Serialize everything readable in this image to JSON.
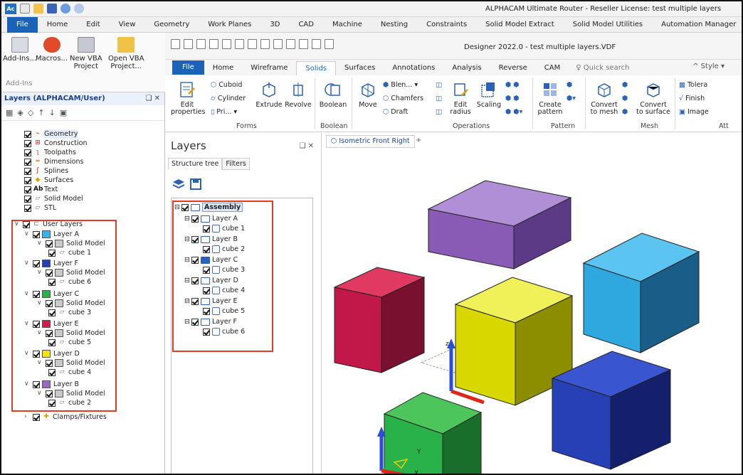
{
  "outer": {
    "app_logo": "Ac",
    "title": "ALPHACAM Ultimate Router - Reseller License: test multiple layers",
    "menu": [
      "File",
      "Home",
      "Edit",
      "View",
      "Geometry",
      "Work Planes",
      "3D",
      "CAD",
      "Machine",
      "Nesting",
      "Constraints",
      "Solid Model Extract",
      "Solid Model Utilities",
      "Automation Manager",
      "Ac"
    ],
    "ribbon": {
      "add_ins": "Add-Ins...",
      "macros": "Macros...",
      "new_vba_1": "New VBA",
      "new_vba_2": "Project",
      "open_vba_1": "Open VBA",
      "open_vba_2": "Project...",
      "group": "Add-Ins"
    }
  },
  "layers_alphacam": {
    "title": "Layers (ALPHACAM/User)",
    "pin": "❑ ✕",
    "tree": [
      {
        "label": "Geometry"
      },
      {
        "label": "Construction"
      },
      {
        "label": "Toolpaths"
      },
      {
        "label": "Dimensions"
      },
      {
        "label": "Splines"
      },
      {
        "label": "Surfaces"
      },
      {
        "label": "Text"
      },
      {
        "label": "Solid Model"
      },
      {
        "label": "STL"
      }
    ],
    "user_layers": "User Layers",
    "layers": [
      {
        "label": "Layer A",
        "color": "#3db2e8",
        "solid": "Solid Model",
        "cube": "cube 1"
      },
      {
        "label": "Layer F",
        "color": "#2240b5",
        "solid": "Solid Model",
        "cube": "cube 6"
      },
      {
        "label": "Layer C",
        "color": "#2ab24a",
        "solid": "Solid Model",
        "cube": "cube 3"
      },
      {
        "label": "Layer E",
        "color": "#d8194c",
        "solid": "Solid Model",
        "cube": "cube 5"
      },
      {
        "label": "Layer D",
        "color": "#f2e600",
        "solid": "Solid Model",
        "cube": "cube 4"
      },
      {
        "label": "Layer B",
        "color": "#9a6ac0",
        "solid": "Solid Model",
        "cube": "cube 2"
      }
    ],
    "clamps": "Clamps/Fixtures"
  },
  "designer": {
    "title": "Designer 2022.0 - test multiple layers.VDF",
    "tabs": [
      "File",
      "Home",
      "Wireframe",
      "Solids",
      "Surfaces",
      "Annotations",
      "Analysis",
      "Reverse",
      "CAM"
    ],
    "active_tab": "Solids",
    "quick_search": "Quick search",
    "style": "Style",
    "ribbon": {
      "edit_props_1": "Edit",
      "edit_props_2": "properties",
      "cuboid": "Cuboid",
      "cylinder": "Cylinder",
      "pri": "Pri...",
      "extrude": "Extrude",
      "revolve": "Revolve",
      "forms": "Forms",
      "boolean": "Boolean",
      "boolean_grp": "Boolean",
      "move": "Move",
      "blen": "Blen...",
      "chamfers": "Chamfers",
      "draft": "Draft",
      "edit_radius_1": "Edit",
      "edit_radius_2": "radius",
      "scaling": "Scaling",
      "operations": "Operations",
      "create_pattern_1": "Create",
      "create_pattern_2": "pattern",
      "pattern": "Pattern",
      "convert_mesh_1": "Convert",
      "convert_mesh_2": "to mesh",
      "convert_surface_1": "Convert",
      "convert_surface_2": "to surface",
      "mesh": "Mesh",
      "tolera": "Tolera",
      "finish": "Finish",
      "image": "Image",
      "att": "Att"
    },
    "layers_panel": {
      "title": "Layers",
      "pin": "❑  ✕",
      "tab_structure": "Structure tree",
      "tab_filters": "Filters",
      "assembly": "Assembly",
      "items": [
        {
          "layer": "Layer A",
          "cube": "cube 1"
        },
        {
          "layer": "Layer B",
          "cube": "cube 2"
        },
        {
          "layer": "Layer C",
          "cube": "cube 3"
        },
        {
          "layer": "Layer D",
          "cube": "cube 4"
        },
        {
          "layer": "Layer E",
          "cube": "cube 5"
        },
        {
          "layer": "Layer F",
          "cube": "cube 6"
        }
      ]
    },
    "view_tab": "Isometric Front Right",
    "view_plus": "+",
    "axis_labels": {
      "z": "z",
      "y": "Y",
      "x": "X"
    }
  }
}
